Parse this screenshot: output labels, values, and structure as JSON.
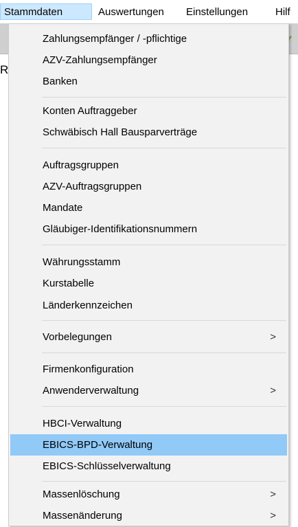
{
  "menubar": {
    "items": [
      {
        "label": "Stammdaten"
      },
      {
        "label": "Auswertungen"
      },
      {
        "label": "Einstellungen"
      },
      {
        "label": "Hilf"
      }
    ]
  },
  "background": {
    "letter": "R"
  },
  "colors": {
    "highlight": "#91c9f7",
    "menu_background": "#f2f2f2",
    "menubar_active": "#cce8ff"
  },
  "dropdown": {
    "items": [
      {
        "label": "Zahlungsempfänger / -pflichtige"
      },
      {
        "label": "AZV-Zahlungsempfänger"
      },
      {
        "label": "Banken"
      },
      {
        "label": "Konten Auftraggeber"
      },
      {
        "label": "Schwäbisch Hall Bausparverträge"
      },
      {
        "label": "Auftragsgruppen"
      },
      {
        "label": "AZV-Auftragsgruppen"
      },
      {
        "label": "Mandate"
      },
      {
        "label": "Gläubiger-Identifikationsnummern"
      },
      {
        "label": "Währungsstamm"
      },
      {
        "label": "Kurstabelle"
      },
      {
        "label": "Länderkennzeichen"
      },
      {
        "label": "Vorbelegungen",
        "submenu": true
      },
      {
        "label": "Firmenkonfiguration"
      },
      {
        "label": "Anwenderverwaltung",
        "submenu": true
      },
      {
        "label": "HBCI-Verwaltung"
      },
      {
        "label": "EBICS-BPD-Verwaltung",
        "highlighted": true
      },
      {
        "label": "EBICS-Schlüsselverwaltung"
      },
      {
        "label": "Massenlöschung",
        "submenu": true
      },
      {
        "label": "Massenänderung",
        "submenu": true
      }
    ],
    "submenu_arrow": ">"
  }
}
